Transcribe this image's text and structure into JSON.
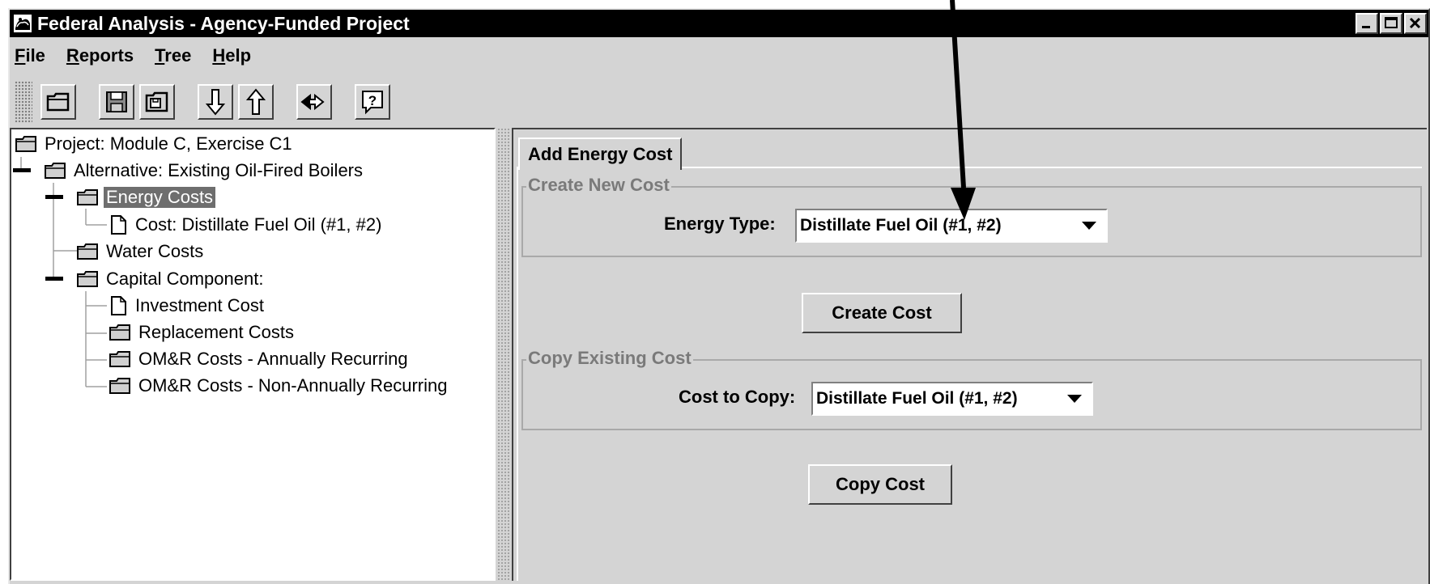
{
  "window": {
    "title": "Federal Analysis - Agency-Funded Project",
    "controls": [
      "minimize-icon",
      "maximize-icon",
      "close-icon"
    ]
  },
  "menu": [
    {
      "label": "File",
      "mnemonic": "F",
      "rest": "ile"
    },
    {
      "label": "Reports",
      "mnemonic": "R",
      "rest": "eports"
    },
    {
      "label": "Tree",
      "mnemonic": "T",
      "rest": "ree"
    },
    {
      "label": "Help",
      "mnemonic": "H",
      "rest": "elp"
    }
  ],
  "toolbar": {
    "buttons": [
      "open-folder-icon",
      "save-icon",
      "save-as-icon",
      "move-down-icon",
      "move-up-icon",
      "rewind-icon",
      "help-icon"
    ]
  },
  "tree": {
    "items": [
      {
        "label": "Project: Module C, Exercise C1",
        "icon": "folder-icon",
        "level": 0
      },
      {
        "label": "Alternative: Existing Oil-Fired Boilers",
        "icon": "folder-icon",
        "level": 1
      },
      {
        "label": "Energy Costs",
        "icon": "folder-icon",
        "level": 2,
        "selected": true
      },
      {
        "label": "Cost: Distillate Fuel Oil (#1, #2)",
        "icon": "document-icon",
        "level": 3
      },
      {
        "label": "Water Costs",
        "icon": "folder-icon",
        "level": 2
      },
      {
        "label": "Capital Component:",
        "icon": "folder-icon",
        "level": 2
      },
      {
        "label": "Investment Cost",
        "icon": "document-icon",
        "level": 3
      },
      {
        "label": "Replacement Costs",
        "icon": "folder-icon",
        "level": 3
      },
      {
        "label": "OM&R Costs - Annually Recurring",
        "icon": "folder-icon",
        "level": 3
      },
      {
        "label": "OM&R Costs - Non-Annually Recurring",
        "icon": "folder-icon",
        "level": 3
      }
    ]
  },
  "panel": {
    "tab_label": "Add Energy Cost",
    "create_group": {
      "title": "Create New Cost",
      "energy_type_label": "Energy Type:",
      "energy_type_value": "Distillate Fuel Oil (#1, #2)",
      "button_label": "Create Cost"
    },
    "copy_group": {
      "title": "Copy Existing Cost",
      "cost_to_copy_label": "Cost to Copy:",
      "cost_to_copy_value": "Distillate Fuel Oil (#1, #2)",
      "button_label": "Copy Cost"
    }
  },
  "colors": {
    "titlebar_bg": "#000000",
    "window_bg": "#d4d4d4",
    "selection_bg": "#6e6e6e",
    "group_title": "#7a7a7a"
  }
}
